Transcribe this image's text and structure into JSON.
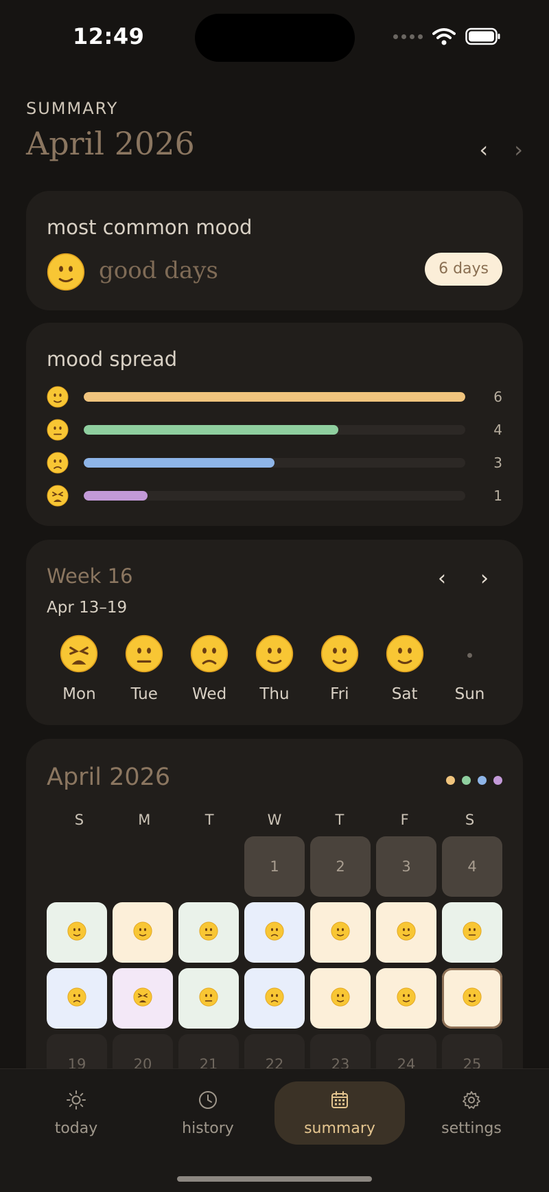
{
  "status_bar": {
    "time": "12:49"
  },
  "header": {
    "eyebrow": "SUMMARY",
    "title": "April 2026",
    "prev_icon": "chevron-left",
    "next_icon": "chevron-right"
  },
  "most_common": {
    "label": "most common mood",
    "mood": "good days",
    "days": "6 days",
    "face": "slight-smile"
  },
  "mood_spread": {
    "label": "mood spread",
    "max": 6,
    "rows": [
      {
        "face": "slight-smile",
        "count": "6",
        "value": 6,
        "color": "#f0c47d"
      },
      {
        "face": "neutral",
        "count": "4",
        "value": 4,
        "color": "#8fcf9f"
      },
      {
        "face": "frown",
        "count": "3",
        "value": 3,
        "color": "#8eb5e8"
      },
      {
        "face": "tired",
        "count": "1",
        "value": 1,
        "color": "#c39ad8"
      }
    ]
  },
  "week": {
    "title": "Week 16",
    "range": "Apr 13–19",
    "days": [
      {
        "label": "Mon",
        "face": "tired"
      },
      {
        "label": "Tue",
        "face": "neutral"
      },
      {
        "label": "Wed",
        "face": "frown"
      },
      {
        "label": "Thu",
        "face": "slight-smile"
      },
      {
        "label": "Fri",
        "face": "slight-smile"
      },
      {
        "label": "Sat",
        "face": "slight-smile"
      },
      {
        "label": "Sun",
        "face": "none"
      }
    ]
  },
  "calendar": {
    "title": "April 2026",
    "legend": [
      "#f0c47d",
      "#8fcf9f",
      "#8eb5e8",
      "#c39ad8"
    ],
    "dow": [
      "S",
      "M",
      "T",
      "W",
      "T",
      "F",
      "S"
    ],
    "cells": [
      {
        "type": "empty"
      },
      {
        "type": "empty"
      },
      {
        "type": "empty"
      },
      {
        "type": "past",
        "label": "1"
      },
      {
        "type": "past",
        "label": "2"
      },
      {
        "type": "past",
        "label": "3"
      },
      {
        "type": "past",
        "label": "4"
      },
      {
        "type": "mood",
        "face": "slight-smile",
        "bg": "#eaf2ea"
      },
      {
        "type": "mood",
        "face": "slight-smile",
        "bg": "#fcefd9"
      },
      {
        "type": "mood",
        "face": "neutral",
        "bg": "#eaf2ea"
      },
      {
        "type": "mood",
        "face": "frown",
        "bg": "#e8eefb"
      },
      {
        "type": "mood",
        "face": "slight-smile",
        "bg": "#fcefd9"
      },
      {
        "type": "mood",
        "face": "slight-smile",
        "bg": "#fcefd9"
      },
      {
        "type": "mood",
        "face": "neutral",
        "bg": "#eaf2ea"
      },
      {
        "type": "mood",
        "face": "frown",
        "bg": "#e8eefb"
      },
      {
        "type": "mood",
        "face": "tired",
        "bg": "#f3e8f7"
      },
      {
        "type": "mood",
        "face": "neutral",
        "bg": "#eaf2ea"
      },
      {
        "type": "mood",
        "face": "frown",
        "bg": "#e8eefb"
      },
      {
        "type": "mood",
        "face": "slight-smile",
        "bg": "#fcefd9"
      },
      {
        "type": "mood",
        "face": "slight-smile",
        "bg": "#fcefd9"
      },
      {
        "type": "mood",
        "face": "slight-smile",
        "bg": "#fcefd9",
        "today": true
      },
      {
        "type": "future",
        "label": "19"
      },
      {
        "type": "future",
        "label": "20"
      },
      {
        "type": "future",
        "label": "21"
      },
      {
        "type": "future",
        "label": "22"
      },
      {
        "type": "future",
        "label": "23"
      },
      {
        "type": "future",
        "label": "24"
      },
      {
        "type": "future",
        "label": "25"
      }
    ]
  },
  "tabs": [
    {
      "label": "today",
      "icon": "sun-icon",
      "active": false
    },
    {
      "label": "history",
      "icon": "clock-icon",
      "active": false
    },
    {
      "label": "summary",
      "icon": "calendar-icon",
      "active": true
    },
    {
      "label": "settings",
      "icon": "gear-icon",
      "active": false
    }
  ]
}
